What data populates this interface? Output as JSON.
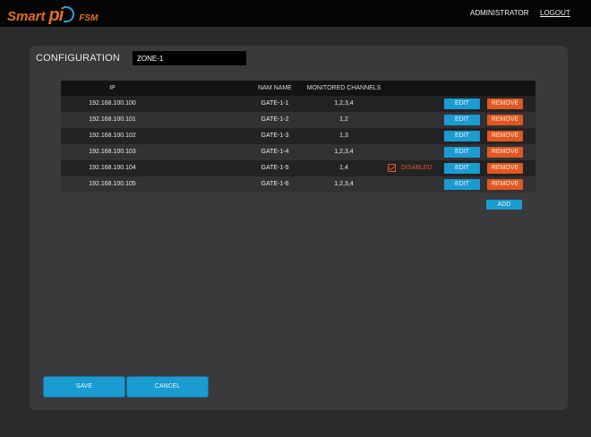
{
  "brand": {
    "smart": "Smart",
    "pi": "pi",
    "fsm": "FSM"
  },
  "header": {
    "user": "ADMINISTRATOR",
    "logout": "LOGOUT"
  },
  "config": {
    "title": "CONFIGURATION",
    "zone": "ZONE-1"
  },
  "table": {
    "columns": [
      "IP",
      "NAM NAME",
      "MONITORED CHANNELS"
    ],
    "rows": [
      {
        "ip": "192.168.100.100",
        "nam": "GATE-1-1",
        "channels": "1,2,3,4"
      },
      {
        "ip": "192.168.100.101",
        "nam": "GATE-1-2",
        "channels": "1,2"
      },
      {
        "ip": "192.168.100.102",
        "nam": "GATE-1-3",
        "channels": "1,3"
      },
      {
        "ip": "192.168.100.103",
        "nam": "GATE-1-4",
        "channels": "1,2,3,4"
      },
      {
        "ip": "192.168.100.104",
        "nam": "GATE-1-5",
        "channels": "1,4",
        "status": "DISABLED"
      },
      {
        "ip": "192.168.100.105",
        "nam": "GATE-1-6",
        "channels": "1,2,3,4"
      }
    ],
    "edit_label": "EDIT",
    "remove_label": "REMOVE",
    "add_label": "ADD"
  },
  "footer": {
    "save_label": "SAVE",
    "cancel_label": "CANCEL"
  },
  "colors": {
    "accent_blue": "#1a9bd1",
    "accent_orange": "#e2571f",
    "brand_orange": "#e2701c"
  }
}
